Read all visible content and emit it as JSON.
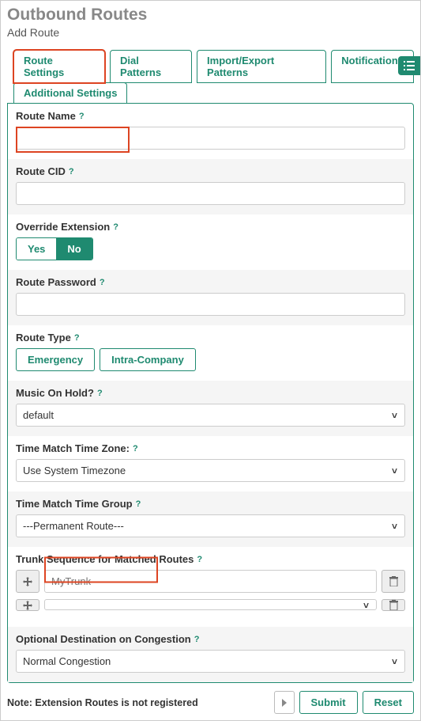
{
  "header": {
    "title": "Outbound Routes",
    "subtitle": "Add Route"
  },
  "tabs": {
    "row1": [
      "Route Settings",
      "Dial Patterns",
      "Import/Export Patterns",
      "Notifications"
    ],
    "row2": [
      "Additional Settings"
    ],
    "active": "Route Settings"
  },
  "fields": {
    "route_name": {
      "label": "Route Name",
      "value": ""
    },
    "route_cid": {
      "label": "Route CID",
      "value": ""
    },
    "override_ext": {
      "label": "Override Extension",
      "options": [
        "Yes",
        "No"
      ],
      "selected": "No"
    },
    "route_password": {
      "label": "Route Password",
      "value": ""
    },
    "route_type": {
      "label": "Route Type",
      "options": [
        "Emergency",
        "Intra-Company"
      ]
    },
    "music_on_hold": {
      "label": "Music On Hold?",
      "value": "default"
    },
    "time_zone": {
      "label": "Time Match Time Zone:",
      "value": "Use System Timezone"
    },
    "time_group": {
      "label": "Time Match Time Group",
      "value": "---Permanent Route---"
    },
    "trunk_seq": {
      "label": "Trunk Sequence for Matched Routes",
      "rows": [
        "MyTrunk",
        ""
      ]
    },
    "opt_dest": {
      "label": "Optional Destination on Congestion",
      "value": "Normal Congestion"
    }
  },
  "footer": {
    "note": "Note: Extension Routes is not registered",
    "submit": "Submit",
    "reset": "Reset"
  }
}
